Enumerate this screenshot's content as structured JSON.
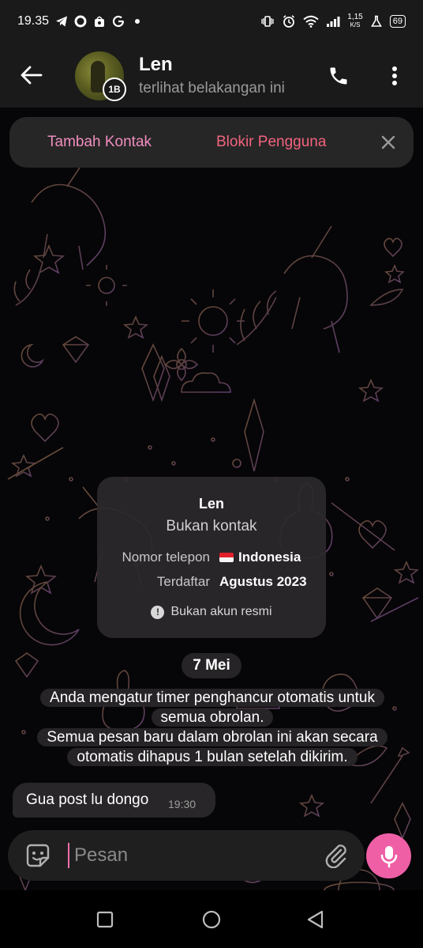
{
  "status_bar": {
    "time": "19.35",
    "data_speed_value": "1,15",
    "data_speed_unit": "K/S",
    "battery": "69"
  },
  "header": {
    "contact_name": "Len",
    "last_seen": "terlihat belakangan ini",
    "timer_badge": "1B"
  },
  "action_bar": {
    "add_contact": "Tambah Kontak",
    "block_user": "Blokir Pengguna"
  },
  "info_card": {
    "name": "Len",
    "status": "Bukan kontak",
    "phone_label": "Nomor telepon",
    "phone_value": "Indonesia",
    "registered_label": "Terdaftar",
    "registered_value": "Agustus 2023",
    "official_note": "Bukan akun resmi"
  },
  "date_chip": "7 Mei",
  "service_message": {
    "line1": "Anda mengatur timer penghancur otomatis untuk",
    "line2": "semua obrolan.",
    "line3": "Semua pesan baru dalam obrolan ini akan secara",
    "line4": "otomatis dihapus 1 bulan setelah dikirim."
  },
  "messages": [
    {
      "text": "Gua post lu dongo",
      "time": "19:30"
    }
  ],
  "composer": {
    "placeholder": "Pesan"
  },
  "colors": {
    "accent_pink": "#ef5fa6",
    "add_contact": "#f08dbf",
    "block_user": "#f2637e",
    "header_bg": "#1a1a1a"
  }
}
